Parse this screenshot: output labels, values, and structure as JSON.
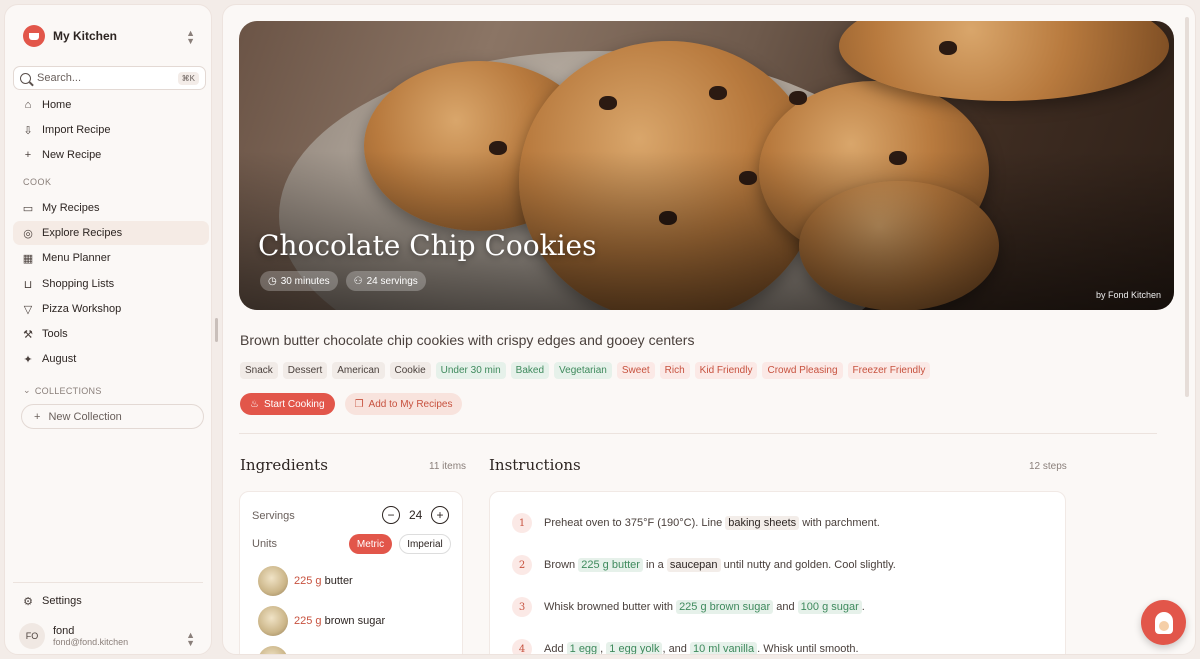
{
  "sidebar": {
    "brand": "My Kitchen",
    "search": {
      "placeholder": "Search...",
      "shortcut": "⌘K"
    },
    "top_items": [
      {
        "label": "Home",
        "icon": "home-icon"
      },
      {
        "label": "Import Recipe",
        "icon": "import-icon"
      },
      {
        "label": "New Recipe",
        "icon": "plus-icon"
      }
    ],
    "cook_label": "COOK",
    "cook_items": [
      {
        "label": "My Recipes",
        "icon": "book-icon"
      },
      {
        "label": "Explore Recipes",
        "icon": "compass-icon",
        "active": true
      },
      {
        "label": "Menu Planner",
        "icon": "calendar-icon"
      },
      {
        "label": "Shopping Lists",
        "icon": "cart-icon"
      },
      {
        "label": "Pizza Workshop",
        "icon": "pizza-icon"
      },
      {
        "label": "Tools",
        "icon": "wrench-icon"
      },
      {
        "label": "August",
        "icon": "sparkle-icon"
      }
    ],
    "collections_label": "COLLECTIONS",
    "new_collection": "New Collection",
    "settings": "Settings",
    "user": {
      "initials": "FO",
      "name": "fond",
      "email": "fond@fond.kitchen"
    }
  },
  "recipe": {
    "title": "Chocolate Chip Cookies",
    "time": "30 minutes",
    "servings_label": "24 servings",
    "by": "by Fond Kitchen",
    "description": "Brown butter chocolate chip cookies with crispy edges and gooey centers",
    "tags": [
      {
        "label": "Snack",
        "style": "neutral"
      },
      {
        "label": "Dessert",
        "style": "neutral"
      },
      {
        "label": "American",
        "style": "neutral"
      },
      {
        "label": "Cookie",
        "style": "neutral"
      },
      {
        "label": "Under 30 min",
        "style": "green"
      },
      {
        "label": "Baked",
        "style": "green"
      },
      {
        "label": "Vegetarian",
        "style": "green"
      },
      {
        "label": "Sweet",
        "style": "red"
      },
      {
        "label": "Rich",
        "style": "red"
      },
      {
        "label": "Kid Friendly",
        "style": "red"
      },
      {
        "label": "Crowd Pleasing",
        "style": "red"
      },
      {
        "label": "Freezer Friendly",
        "style": "red"
      }
    ],
    "start_cooking": "Start Cooking",
    "add_to_my_recipes": "Add to My Recipes"
  },
  "ingredients": {
    "heading": "Ingredients",
    "count": "11 items",
    "servings_label": "Servings",
    "servings_value": "24",
    "units_label": "Units",
    "unit_metric": "Metric",
    "unit_imperial": "Imperial",
    "items": [
      {
        "qty": "225 g",
        "name": "butter"
      },
      {
        "qty": "225 g",
        "name": "brown sugar"
      }
    ]
  },
  "instructions": {
    "heading": "Instructions",
    "count": "12 steps",
    "steps": [
      {
        "num": "1",
        "parts": [
          {
            "t": "Preheat oven to 375°F (190°C). Line "
          },
          {
            "t": "baking sheets",
            "k": "tool"
          },
          {
            "t": " with parchment."
          }
        ]
      },
      {
        "num": "2",
        "parts": [
          {
            "t": "Brown "
          },
          {
            "t": "225 g butter",
            "k": "ing"
          },
          {
            "t": " in a "
          },
          {
            "t": "saucepan",
            "k": "tool"
          },
          {
            "t": " until nutty and golden. Cool slightly."
          }
        ]
      },
      {
        "num": "3",
        "parts": [
          {
            "t": "Whisk browned butter with "
          },
          {
            "t": "225 g brown sugar",
            "k": "ing"
          },
          {
            "t": " and "
          },
          {
            "t": "100 g sugar",
            "k": "ing"
          },
          {
            "t": "."
          }
        ]
      },
      {
        "num": "4",
        "parts": [
          {
            "t": "Add "
          },
          {
            "t": "1 egg",
            "k": "ing"
          },
          {
            "t": ", "
          },
          {
            "t": "1 egg yolk",
            "k": "ing"
          },
          {
            "t": ", and "
          },
          {
            "t": "10 ml vanilla",
            "k": "ing"
          },
          {
            "t": ". Whisk until smooth."
          }
        ]
      }
    ]
  },
  "colors": {
    "accent": "#e2564a",
    "green": "#3f8a5d",
    "red_text": "#c7523f"
  }
}
